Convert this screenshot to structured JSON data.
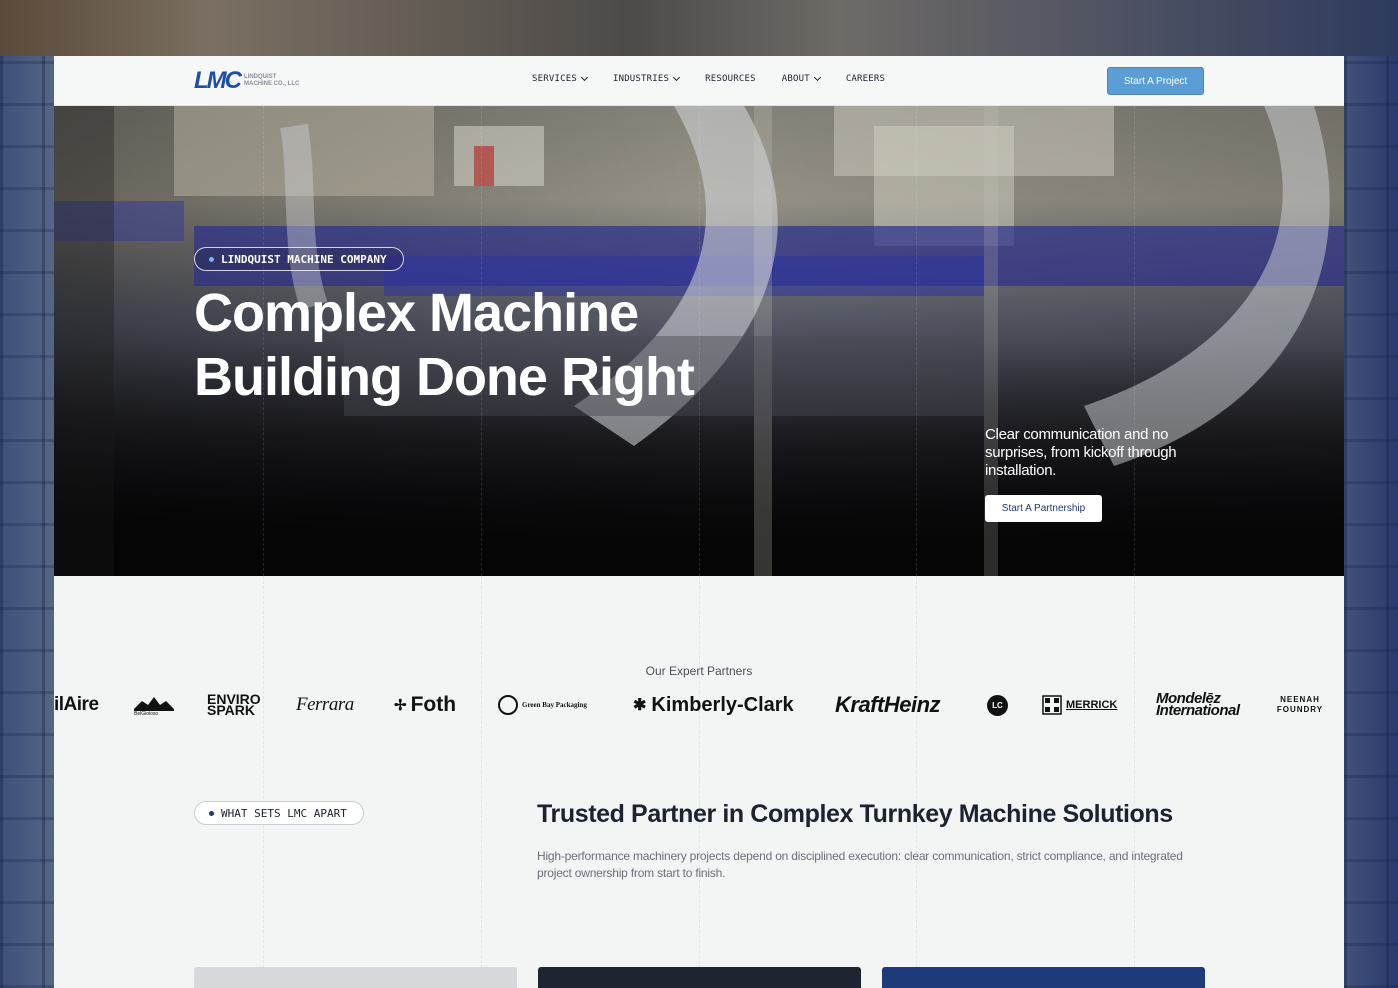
{
  "header": {
    "logo": {
      "mark": "LMC",
      "line1": "LINDQUIST",
      "line2": "MACHINE CO., LLC"
    },
    "nav": [
      {
        "label": "SERVICES",
        "dropdown": true
      },
      {
        "label": "INDUSTRIES",
        "dropdown": true
      },
      {
        "label": "RESOURCES",
        "dropdown": false
      },
      {
        "label": "ABOUT",
        "dropdown": true
      },
      {
        "label": "CAREERS",
        "dropdown": false
      }
    ],
    "cta_label": "Start A Project"
  },
  "hero": {
    "tag": "LINDQUIST MACHINE COMPANY",
    "title_line1": "Complex Machine",
    "title_line2": "Building Done Right",
    "text": "Clear communication and no surprises, from kickoff through installation.",
    "button_label": "Start A Partnership"
  },
  "partners": {
    "title": "Our Expert Partners",
    "logos": [
      "ilAire",
      "BelGioioso",
      "ENVIRO SPARK",
      "Ferrara",
      "Foth",
      "Green Bay Packaging",
      "Kimberly-Clark",
      "KraftHeinz",
      "LC",
      "MERRICK",
      "Mondelēz International",
      "NEENAH FOUNDRY"
    ]
  },
  "apart": {
    "tag": "WHAT SETS LMC APART",
    "title": "Trusted Partner in Complex Turnkey Machine Solutions",
    "text": "High-performance machinery projects depend on disciplined execution: clear communication, strict compliance, and integrated project ownership from start to finish."
  },
  "colors": {
    "brand_blue": "#1d4fa8",
    "cta_blue": "#5b9ed6",
    "navy": "#1e3a78",
    "page_bg": "#f3f5f5"
  }
}
